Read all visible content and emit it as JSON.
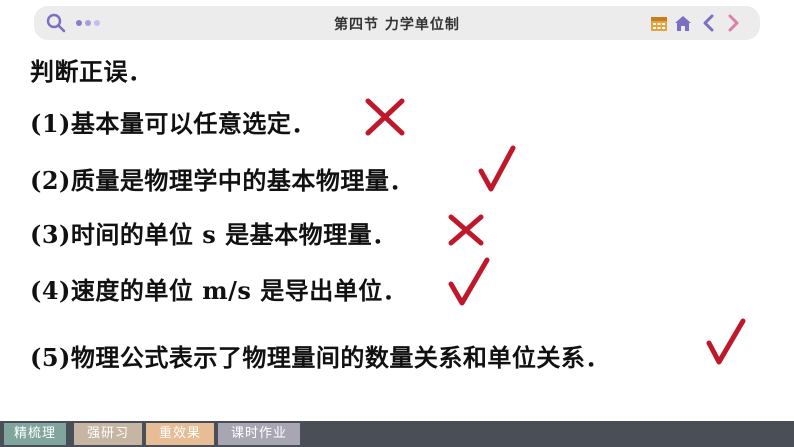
{
  "header": {
    "title": "第四节  力学单位制",
    "icons": [
      "search-icon",
      "dots-menu-icon",
      "calendar-icon",
      "home-icon",
      "chevron-left-icon",
      "chevron-right-icon"
    ]
  },
  "heading": "判断正误．",
  "items": [
    {
      "text": "(1)基本量可以任意选定．",
      "mark": "cross"
    },
    {
      "text": "(2)质量是物理学中的基本物理量．",
      "mark": "check"
    },
    {
      "text": "(3)时间的单位 s 是基本物理量．",
      "mark": "cross"
    },
    {
      "text": "(4)速度的单位 m/s 是导出单位．",
      "mark": "check"
    },
    {
      "text": "(5)物理公式表示了物理量间的数量关系和单位关系．",
      "mark": "check"
    }
  ],
  "tabs": [
    {
      "label": "精梳理"
    },
    {
      "label": "强研习"
    },
    {
      "label": "重效果"
    },
    {
      "label": "课时作业"
    }
  ],
  "colors": {
    "mark": "#c0182b",
    "topbar": "#ececec",
    "bottombar": "#4a4e57",
    "tab1": "#80a59d",
    "tab2": "#c6b5a3",
    "tab3": "#e7bd95",
    "tab4": "#a8a6b3"
  }
}
